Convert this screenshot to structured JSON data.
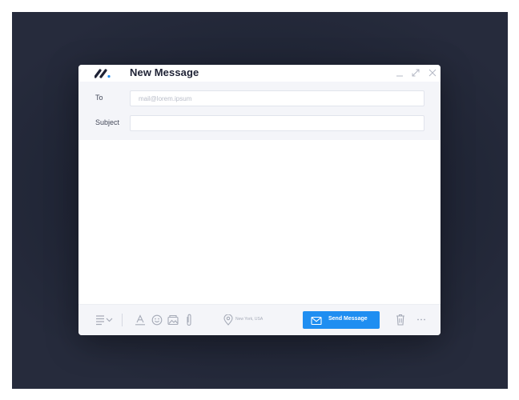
{
  "window": {
    "title": "New Message",
    "logo_icon": "brand-logo-icon"
  },
  "fields": {
    "to_label": "To",
    "to_placeholder": "mail@lorem.ipsum",
    "to_value": "",
    "subject_label": "Subject",
    "subject_value": ""
  },
  "toolbar": {
    "location_text": "New York, USA",
    "send_label": "Send Message",
    "icons": [
      "align-icon",
      "chevron-down-icon",
      "font-color-icon",
      "emoji-icon",
      "image-icon",
      "attachment-icon",
      "location-pin-icon",
      "envelope-icon",
      "trash-icon",
      "more-icon"
    ]
  },
  "colors": {
    "accent": "#1f8ef1",
    "brand": "#1e2235",
    "background": "#1d2232"
  }
}
